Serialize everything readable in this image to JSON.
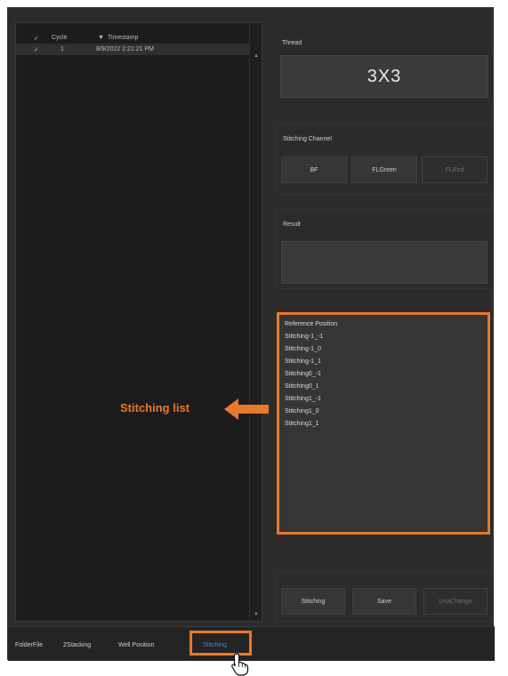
{
  "table": {
    "headers": {
      "check": "✓",
      "cycle": "Cycle",
      "sort": "▼",
      "timestamp": "Timestamp"
    },
    "rows": [
      {
        "check": "✓",
        "cycle": "1",
        "timestamp": "8/9/2022 2:21:21 PM"
      }
    ]
  },
  "thread": {
    "label": "Thread",
    "value": "3X3"
  },
  "stitching_channel": {
    "label": "Stitching Channel",
    "buttons": [
      {
        "label": "BF",
        "enabled": true
      },
      {
        "label": "FLGreen",
        "enabled": true
      },
      {
        "label": "FLRed",
        "enabled": false
      }
    ]
  },
  "result": {
    "label": "Result"
  },
  "reference_list": {
    "items": [
      "Reference Position",
      "Stitching-1_-1",
      "Stitching-1_0",
      "Stitching-1_1",
      "Stitching0_-1",
      "Stitching0_1",
      "Stitching1_-1",
      "Stitching1_0",
      "Stitching1_1"
    ]
  },
  "actions": [
    {
      "label": "Stitching",
      "enabled": true
    },
    {
      "label": "Save",
      "enabled": true
    },
    {
      "label": "UnaChange",
      "enabled": false
    }
  ],
  "tabs": [
    {
      "label": "FolderFile",
      "active": false
    },
    {
      "label": "ZStacking",
      "active": false
    },
    {
      "label": "Well Position",
      "active": false
    },
    {
      "label": "Stitching",
      "active": true
    }
  ],
  "annotation": {
    "label": "Stitching list"
  },
  "colors": {
    "accent": "#e8782a",
    "active_tab": "#3a8ad8",
    "panel": "#2b2b2b"
  },
  "icons": {
    "pointer": "hand-pointer-icon",
    "arrow": "left-arrow-icon"
  }
}
